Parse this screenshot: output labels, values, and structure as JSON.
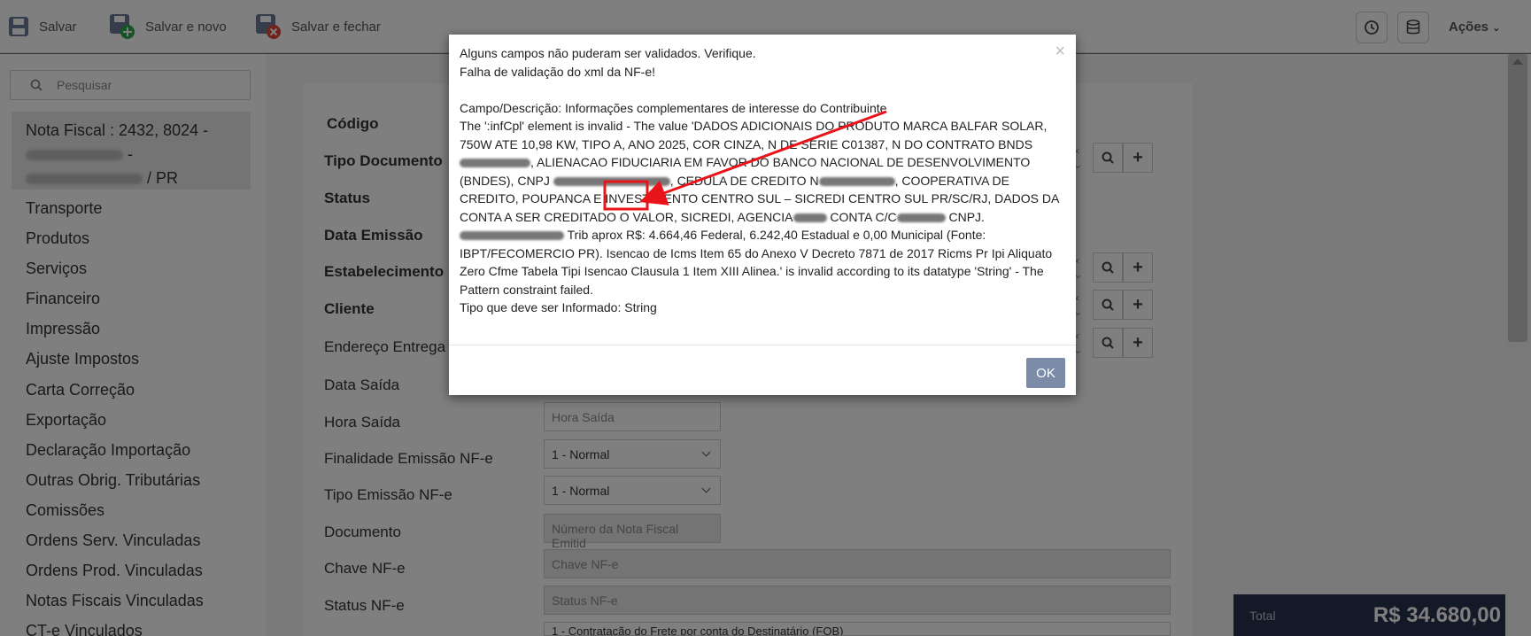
{
  "toolbar": {
    "save_label": "Salvar",
    "save_new_label": "Salvar e novo",
    "save_close_label": "Salvar e fechar",
    "actions_label": "Ações"
  },
  "sidebar": {
    "search_placeholder": "Pesquisar",
    "record_title": "Nota Fiscal : 2432, 8024 -",
    "record_line2": "-",
    "record_state": "/ PR",
    "items": [
      {
        "label": "Transporte"
      },
      {
        "label": "Produtos"
      },
      {
        "label": "Serviços"
      },
      {
        "label": "Financeiro"
      },
      {
        "label": "Impressão"
      },
      {
        "label": "Ajuste Impostos"
      },
      {
        "label": "Carta Correção"
      },
      {
        "label": "Exportação"
      },
      {
        "label": "Declaração Importação"
      },
      {
        "label": "Outras Obrig. Tributárias"
      },
      {
        "label": "Comissões"
      },
      {
        "label": "Ordens Serv. Vinculadas"
      },
      {
        "label": "Ordens Prod. Vinculadas"
      },
      {
        "label": "Notas Fiscais Vinculadas"
      },
      {
        "label": "CT-e Vinculados"
      }
    ]
  },
  "form": {
    "labels": {
      "codigo": "Código",
      "tipo_documento": "Tipo Documento",
      "status": "Status",
      "data_emissao": "Data Emissão",
      "estabelecimento": "Estabelecimento",
      "cliente": "Cliente",
      "endereco_entrega": "Endereço Entrega",
      "data_saida": "Data Saída",
      "hora_saida": "Hora Saída",
      "finalidade": "Finalidade Emissão NF-e",
      "tipo_emissao": "Tipo Emissão NF-e",
      "documento": "Documento",
      "chave": "Chave NF-e",
      "status_nfe": "Status NF-e"
    },
    "hora_saida_placeholder": "Hora Saída",
    "finalidade_value": "1 - Normal",
    "tipo_emissao_value": "1 - Normal",
    "documento_placeholder": "Número da Nota Fiscal Emitid",
    "chave_placeholder": "Chave NF-e",
    "status_nfe_placeholder": "Status NF-e",
    "partial_select": "1 - Contratação do Frete por conta do Destinatário (FOB)"
  },
  "total": {
    "label": "Total",
    "value": "R$ 34.680,00"
  },
  "modal": {
    "line1": "Alguns campos não puderam ser validados. Verifique.",
    "line2": "Falha de validação do xml da NF-e!",
    "campo": "Campo/Descrição: Informações complementares de interesse do Contribuinte",
    "msg_a": "The ':infCpl' element is invalid - The value 'DADOS ADICIONAIS DO PRODUTO MARCA BALFAR SOLAR, 750W ATE 10,98 KW, TIPO A, ANO 2025, COR CINZA, N DE SERIE C01387, N DO CONTRATO BNDS",
    "msg_b": ", ALIENACAO FIDUCIARIA EM FAVOR DO BANCO NACIONAL DE DESENVOLVIMENTO (BNDES), CNPJ",
    "msg_c": ", CEDULA DE CREDITO N",
    "msg_d": ", COOPERATIVA DE CREDITO, POUPANCA E INVESTIMENTO CENTRO SUL – SICREDI CENTRO SUL PR/SC/RJ, DADOS DA CONTA A SER CREDITADO O VALOR, SICREDI, AGENCIA",
    "msg_e": " CONTA C/C",
    "msg_f": " CNPJ.",
    "msg_g": " Trib aprox R$: 4.664,46 Federal, 6.242,40 Estadual e 0,00 Municipal (Fonte: IBPT/FECOMERCIO PR). Isencao de Icms Item 65 do Anexo V Decreto 7871 de 2017 Ricms Pr Ipi Aliquato Zero Cfme Tabela Tipi Isencao Clausula 1 Item XIII Alinea.' is invalid according to its datatype 'String' - The Pattern constraint failed.",
    "tipo": "Tipo que deve ser Informado: String",
    "ok_label": "OK",
    "close_glyph": "×"
  },
  "annotation_color": "#e8141a"
}
